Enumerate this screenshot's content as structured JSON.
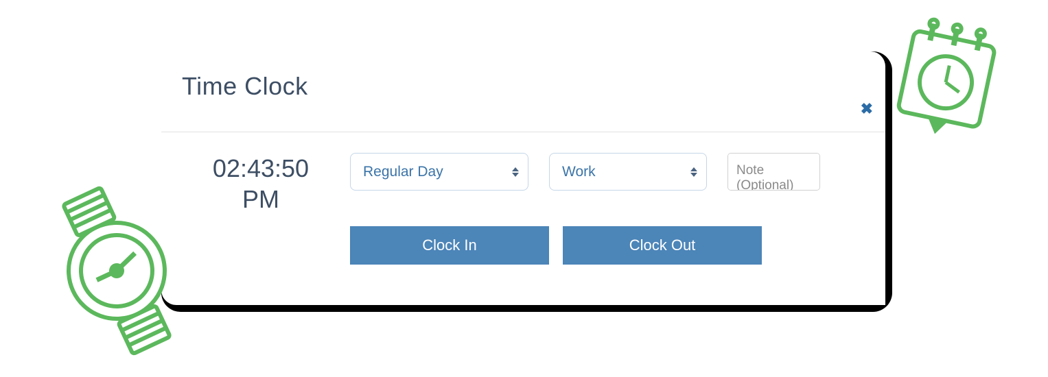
{
  "header": {
    "title": "Time Clock"
  },
  "time": {
    "value": "02:43:50",
    "period": "PM"
  },
  "dayType": {
    "selected": "Regular Day"
  },
  "activity": {
    "selected": "Work"
  },
  "note": {
    "placeholder": "Note (Optional)"
  },
  "buttons": {
    "clockIn": "Clock In",
    "clockOut": "Clock Out"
  },
  "colors": {
    "accent": "#4c85b8",
    "decorGreen": "#5cb85c"
  }
}
